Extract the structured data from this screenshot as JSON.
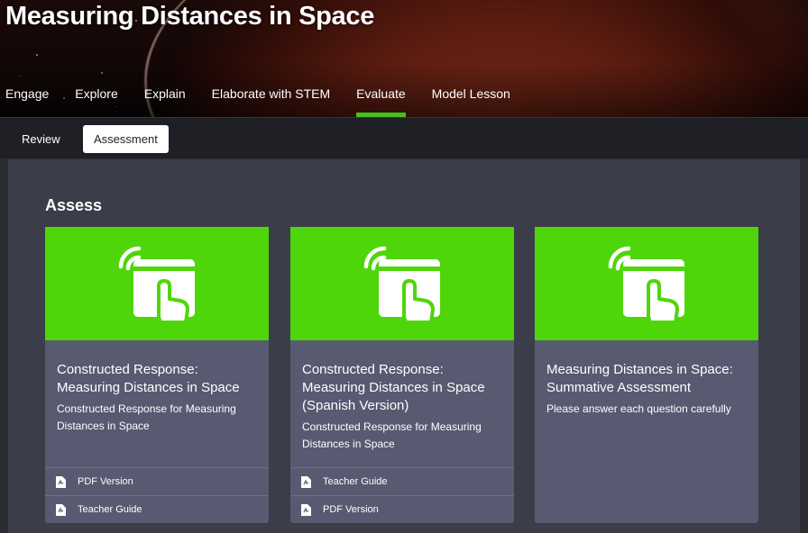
{
  "header": {
    "title": "Measuring Distances in Space",
    "tabs": [
      {
        "label": "Engage"
      },
      {
        "label": "Explore"
      },
      {
        "label": "Explain"
      },
      {
        "label": "Elaborate with STEM"
      },
      {
        "label": "Evaluate"
      },
      {
        "label": "Model Lesson"
      }
    ],
    "active_tab": "Evaluate"
  },
  "subnav": {
    "items": [
      {
        "label": "Review"
      },
      {
        "label": "Assessment"
      }
    ],
    "active": "Assessment"
  },
  "section": {
    "title": "Assess"
  },
  "cards": [
    {
      "icon": "interactive-touch-icon",
      "title": "Constructed Response: Measuring Distances in Space",
      "description": "Constructed Response for Measuring Distances in Space",
      "links": [
        {
          "label": "PDF Version",
          "icon": "pdf-file-icon"
        },
        {
          "label": "Teacher Guide",
          "icon": "pdf-file-icon"
        }
      ]
    },
    {
      "icon": "interactive-touch-icon",
      "title": "Constructed Response: Measuring Distances in Space (Spanish Version)",
      "description": "Constructed Response for Measuring Distances in Space",
      "links": [
        {
          "label": "Teacher Guide",
          "icon": "pdf-file-icon"
        },
        {
          "label": "PDF Version",
          "icon": "pdf-file-icon"
        }
      ]
    },
    {
      "icon": "interactive-touch-icon",
      "title": "Measuring Distances in Space: Summative Assessment",
      "description": "Please answer each question carefully",
      "links": []
    }
  ],
  "colors": {
    "accent_green": "#4fd60a",
    "tab_underline": "#42c21a",
    "card_bg": "#575a70",
    "content_bg": "#3b3d48",
    "subnav_bg": "#1f2025"
  }
}
